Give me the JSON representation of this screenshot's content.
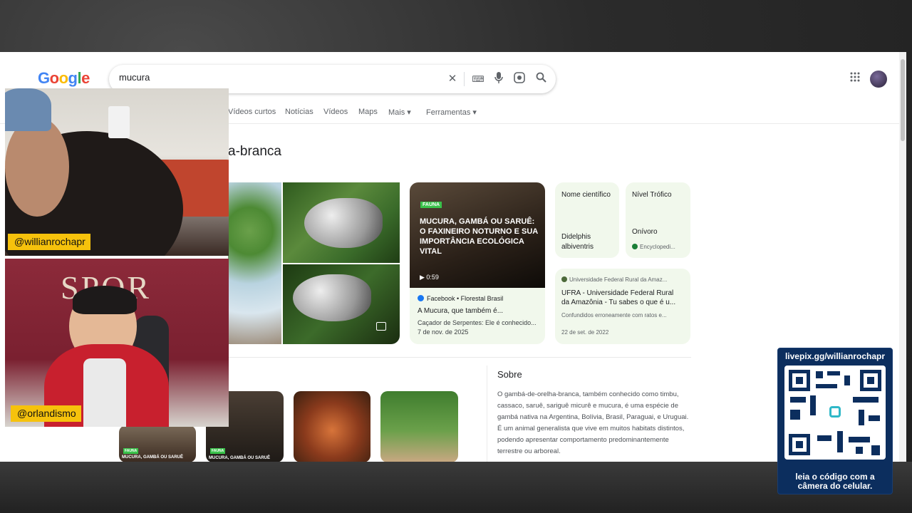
{
  "search": {
    "query": "mucura"
  },
  "logo": {
    "letters": [
      "G",
      "o",
      "o",
      "g",
      "l",
      "e"
    ],
    "colors": [
      "#4285f4",
      "#ea4335",
      "#fbbc05",
      "#4285f4",
      "#34a853",
      "#ea4335"
    ]
  },
  "tabs": [
    "Vídeos curtos",
    "Notícias",
    "Vídeos",
    "Maps",
    "Mais ▾",
    "Ferramentas ▾"
  ],
  "title_fragment": "a-branca",
  "video": {
    "tag": "FAUNA",
    "headline": "MUCURA, GAMBÁ OU SARUÊ: O FAXINEIRO NOTURNO E SUA IMPORTÂNCIA ECOLÓGICA VITAL",
    "duration": "▶ 0:59",
    "source": "Facebook • Florestal Brasil",
    "title": "A Mucura, que também é...",
    "snippet": "Caçador de Serpentes: Ele é conhecido...",
    "date": "7 de nov. de 2025"
  },
  "info_sci": {
    "label": "Nome científico",
    "value_line1": "Didelphis",
    "value_line2": "albiventris"
  },
  "info_trophic": {
    "label": "Nível Trófico",
    "value": "Onívoro",
    "source": "Encyclopedi..."
  },
  "ufra": {
    "source": "Universidade Federal Rural da Amaz...",
    "title1": "UFRA - Universidade Federal Rural",
    "title2": "da Amazônia - Tu sabes o que é u...",
    "snippet": "Confundidos erroneamente com ratos e...",
    "date": "22 de set. de 2022"
  },
  "sobre": {
    "heading": "Sobre",
    "text": "O gambá-de-orelha-branca, também conhecido como timbu, cassaco, saruê, sariguê micurê e mucura, é uma espécie de gambá nativa na Argentina, Bolívia, Brasil, Paraguai, e Uruguai. É um animal generalista que vive em muitos habitats distintos, podendo apresentar comportamento predominantemente terrestre ou arboreal."
  },
  "bottom_cards": {
    "tag": "FAUNA",
    "caption": "MUCURA, GAMBÁ OU SARUÊ"
  },
  "streamers": {
    "top": "@willianrochapr",
    "bottom": "@orlandismo"
  },
  "cam_banner": "SPQR",
  "qr": {
    "link": "livepix.gg/willianrochapr",
    "footer1": "leia o código com a",
    "footer2": "câmera do celular."
  }
}
